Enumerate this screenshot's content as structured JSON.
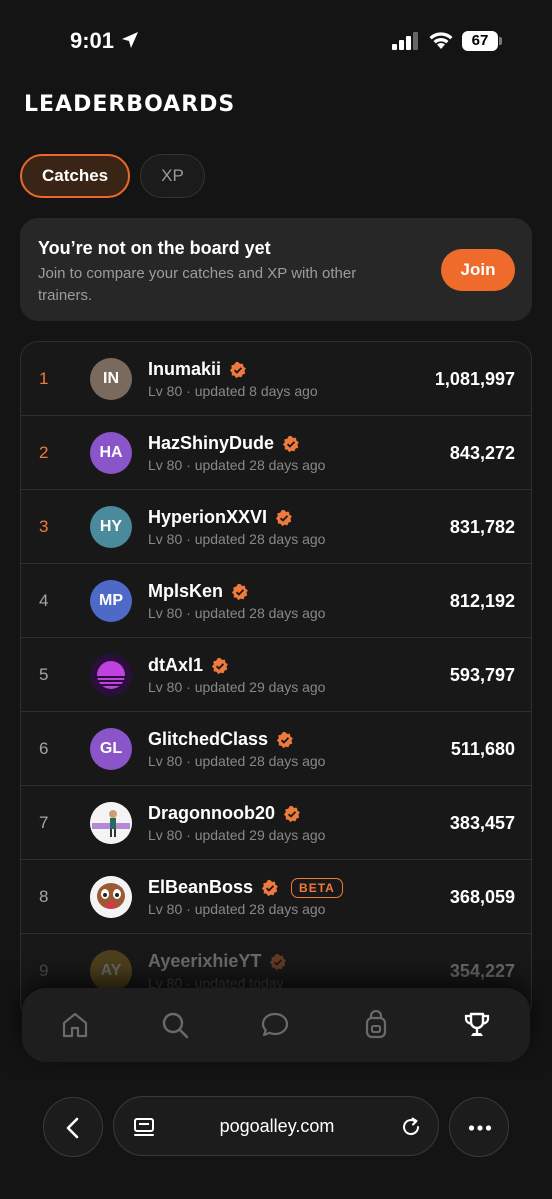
{
  "status": {
    "time": "9:01",
    "battery": "67"
  },
  "title": "LEADERBOARDS",
  "tabs": [
    {
      "label": "Catches",
      "active": true
    },
    {
      "label": "XP",
      "active": false
    }
  ],
  "join_card": {
    "title": "You’re not on the board yet",
    "subtitle": "Join to compare your catches and XP with other trainers.",
    "button": "Join"
  },
  "leaderboard": [
    {
      "rank": "1",
      "initials": "IN",
      "avatar_color": "#7a6a5e",
      "name": "Inumakii",
      "meta": "Lv 80 · updated 8 days ago",
      "score": "1,081,997"
    },
    {
      "rank": "2",
      "initials": "HA",
      "avatar_color": "#8a55c9",
      "name": "HazShinyDude",
      "meta": "Lv 80 · updated 28 days ago",
      "score": "843,272"
    },
    {
      "rank": "3",
      "initials": "HY",
      "avatar_color": "#4a8a9c",
      "name": "HyperionXXVI",
      "meta": "Lv 80 · updated 28 days ago",
      "score": "831,782"
    },
    {
      "rank": "4",
      "initials": "MP",
      "avatar_color": "#4f69c9",
      "name": "MplsKen",
      "meta": "Lv 80 · updated 28 days ago",
      "score": "812,192"
    },
    {
      "rank": "5",
      "initials": "",
      "avatar_color": "#2a0f3a",
      "name": "dtAxl1",
      "meta": "Lv 80 · updated 29 days ago",
      "score": "593,797"
    },
    {
      "rank": "6",
      "initials": "GL",
      "avatar_color": "#8a55c9",
      "name": "GlitchedClass",
      "meta": "Lv 80 · updated 28 days ago",
      "score": "511,680"
    },
    {
      "rank": "7",
      "initials": "",
      "avatar_color": "#f2f2f2",
      "name": "Dragonnoob20",
      "meta": "Lv 80 · updated 29 days ago",
      "score": "383,457"
    },
    {
      "rank": "8",
      "initials": "",
      "avatar_color": "#f2f2f2",
      "name": "ElBeanBoss",
      "badge": "BETA",
      "meta": "Lv 80 · updated 28 days ago",
      "score": "368,059"
    },
    {
      "rank": "9",
      "initials": "AY",
      "avatar_color": "#b08a2a",
      "name": "AyeerixhieYT",
      "meta": "Lv 80 · updated today",
      "score": "354,227"
    }
  ],
  "nav": [
    "home-icon",
    "search-icon",
    "chat-icon",
    "backpack-icon",
    "trophy-icon"
  ],
  "browser": {
    "url": "pogoalley.com"
  },
  "colors": {
    "accent": "#ee6b2c",
    "background": "#141414"
  }
}
